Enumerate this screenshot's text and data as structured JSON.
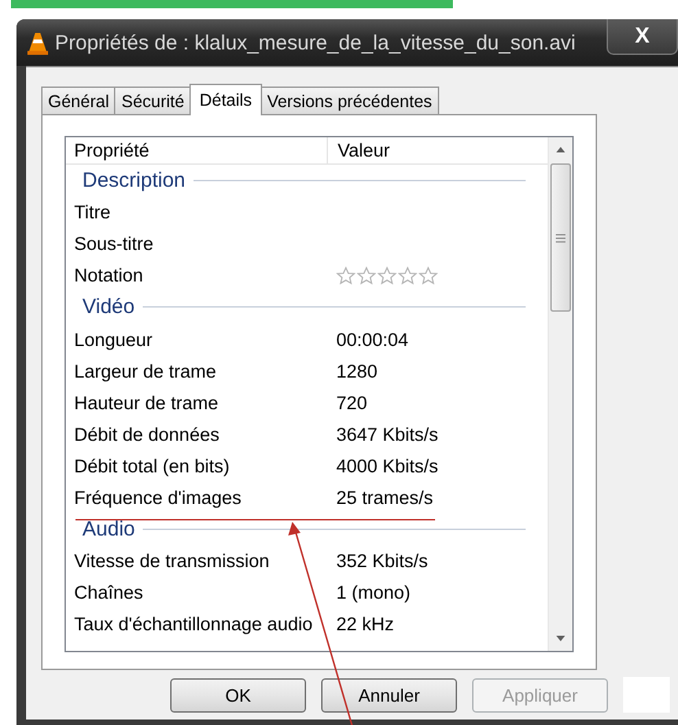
{
  "window": {
    "title": "Propriétés de : klalux_mesure_de_la_vitesse_du_son.avi",
    "close": "X"
  },
  "tabs": [
    {
      "label": "Général",
      "selected": false
    },
    {
      "label": "Sécurité",
      "selected": false
    },
    {
      "label": "Détails",
      "selected": true
    },
    {
      "label": "Versions précédentes",
      "selected": false
    }
  ],
  "list": {
    "columns": [
      "Propriété",
      "Valeur"
    ],
    "rows": [
      {
        "kind": "section",
        "label": "Description"
      },
      {
        "kind": "property",
        "label": "Titre"
      },
      {
        "kind": "property",
        "label": "Sous-titre"
      },
      {
        "kind": "rating",
        "label": "Notation",
        "stars": 0
      },
      {
        "kind": "section",
        "label": "Vidéo"
      },
      {
        "kind": "property",
        "label": "Longueur",
        "value": "00:00:04"
      },
      {
        "kind": "property",
        "label": "Largeur de trame",
        "value": "1280"
      },
      {
        "kind": "property",
        "label": "Hauteur de trame",
        "value": "720"
      },
      {
        "kind": "property",
        "label": "Débit de données",
        "value": "3647 Kbits/s"
      },
      {
        "kind": "property",
        "label": "Débit total (en bits)",
        "value": "4000 Kbits/s"
      },
      {
        "kind": "property",
        "label": "Fréquence d'images",
        "value": "25 trames/s"
      },
      {
        "kind": "section",
        "label": "Audio"
      },
      {
        "kind": "property",
        "label": "Vitesse de transmission",
        "value": "352 Kbits/s"
      },
      {
        "kind": "property",
        "label": "Chaînes",
        "value": "1 (mono)"
      },
      {
        "kind": "property",
        "label": "Taux d'échantillonnage audio",
        "value": "22 kHz"
      }
    ]
  },
  "buttons": [
    {
      "label": "OK",
      "disabled": false
    },
    {
      "label": "Annuler",
      "disabled": false
    },
    {
      "label": "Appliquer",
      "disabled": true
    }
  ]
}
